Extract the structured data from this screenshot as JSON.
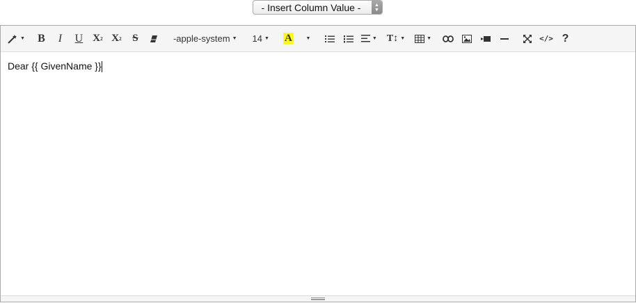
{
  "insert_select": {
    "label": "- Insert Column Value -"
  },
  "toolbar": {
    "bold": "B",
    "italic": "I",
    "underline": "U",
    "superscript": "X",
    "subscript": "X",
    "strikethrough": "S",
    "font_family": "-apple-system",
    "font_size": "14",
    "highlight": "A",
    "help": "?",
    "codeview": "</>",
    "line_height": "T↕"
  },
  "editor": {
    "content": "Dear {{ GivenName }}"
  },
  "colors": {
    "highlight": "#ffff00"
  }
}
